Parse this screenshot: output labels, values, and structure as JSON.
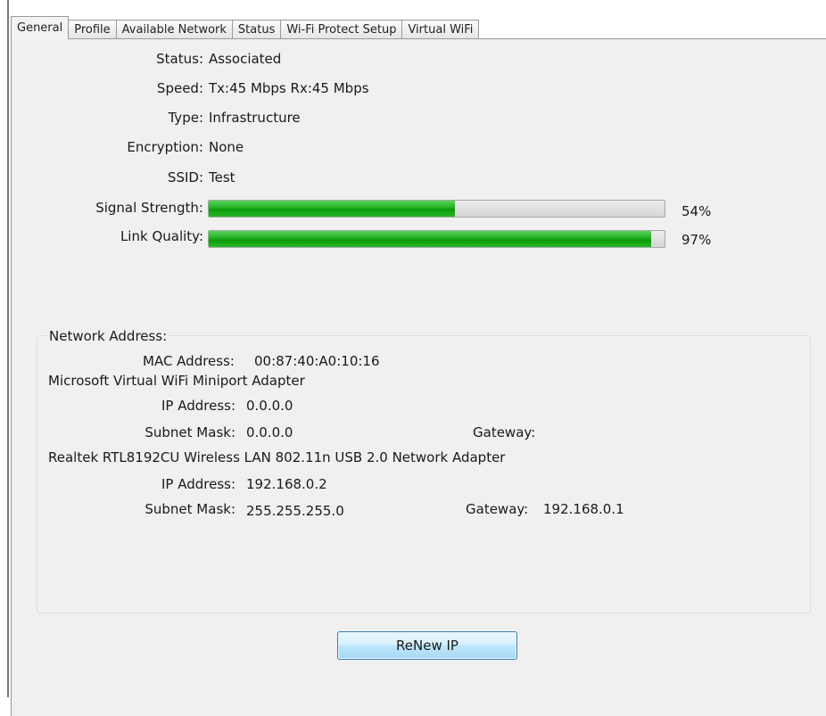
{
  "tabs": [
    {
      "label": "General"
    },
    {
      "label": "Profile"
    },
    {
      "label": "Available Network"
    },
    {
      "label": "Status"
    },
    {
      "label": "Wi-Fi Protect Setup"
    },
    {
      "label": "Virtual WiFi"
    }
  ],
  "general": {
    "status_label": "Status:",
    "status_value": "Associated",
    "speed_label": "Speed:",
    "speed_value": "Tx:45 Mbps Rx:45 Mbps",
    "type_label": "Type:",
    "type_value": "Infrastructure",
    "encryption_label": "Encryption:",
    "encryption_value": "None",
    "ssid_label": "SSID:",
    "ssid_value": "Test",
    "signal_label": "Signal Strength:",
    "signal_percent": 54,
    "signal_text": "54%",
    "link_label": "Link Quality:",
    "link_percent": 97,
    "link_text": "97%"
  },
  "network": {
    "title": "Network Address:",
    "mac_label": "MAC Address:",
    "mac_value": "00:87:40:A0:10:16",
    "adapters": [
      {
        "name": "Microsoft Virtual WiFi Miniport Adapter",
        "ip_label": "IP Address:",
        "ip_value": "0.0.0.0",
        "subnet_label": "Subnet Mask:",
        "subnet_value": "0.0.0.0",
        "gateway_label": "Gateway:",
        "gateway_value": ""
      },
      {
        "name": "Realtek RTL8192CU Wireless LAN 802.11n USB 2.0 Network Adapter",
        "ip_label": "IP Address:",
        "ip_value": "192.168.0.2",
        "subnet_label": "Subnet Mask:",
        "subnet_value": "255.255.255.0",
        "gateway_label": "Gateway:",
        "gateway_value": "192.168.0.1"
      }
    ]
  },
  "actions": {
    "renew_label": "ReNew IP"
  },
  "colors": {
    "progress_green": "#1fae1f",
    "button_border": "#3c7fb1"
  }
}
